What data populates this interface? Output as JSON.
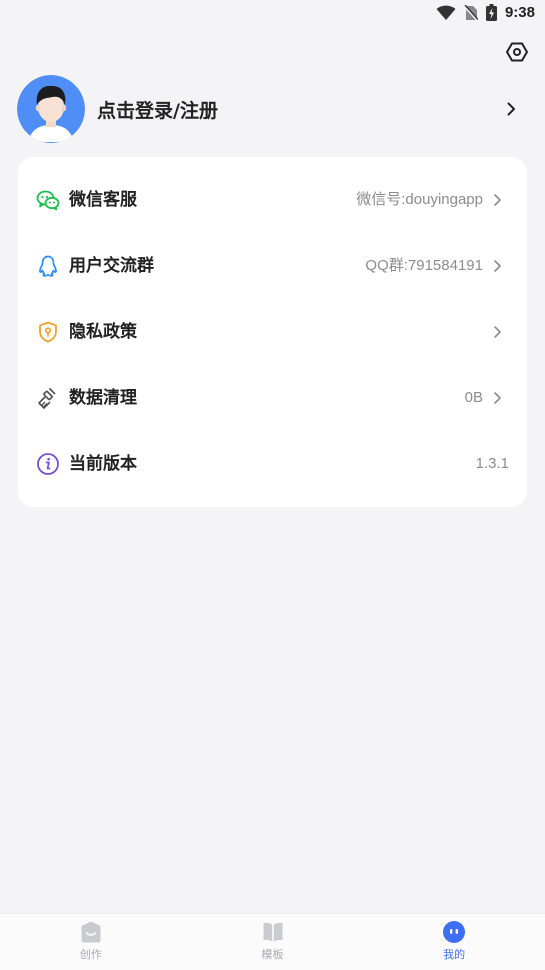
{
  "status_bar": {
    "time": "9:38"
  },
  "profile": {
    "login_label": "点击登录/注册"
  },
  "menu": [
    {
      "label": "微信客服",
      "value": "微信号:douyingapp",
      "icon": "wechat-icon",
      "has_arrow": true
    },
    {
      "label": "用户交流群",
      "value": "QQ群:791584191",
      "icon": "qq-icon",
      "has_arrow": true
    },
    {
      "label": "隐私政策",
      "value": "",
      "icon": "shield-icon",
      "has_arrow": true
    },
    {
      "label": "数据清理",
      "value": "0B",
      "icon": "broom-icon",
      "has_arrow": true
    },
    {
      "label": "当前版本",
      "value": "1.3.1",
      "icon": "info-icon",
      "has_arrow": false
    }
  ],
  "bottom_nav": [
    {
      "label": "创作",
      "icon": "create-icon",
      "active": false
    },
    {
      "label": "模板",
      "icon": "template-icon",
      "active": false
    },
    {
      "label": "我的",
      "icon": "profile-icon",
      "active": true
    }
  ],
  "colors": {
    "accent": "#3d6ff2",
    "background": "#f4f4f6",
    "card": "#ffffff"
  }
}
